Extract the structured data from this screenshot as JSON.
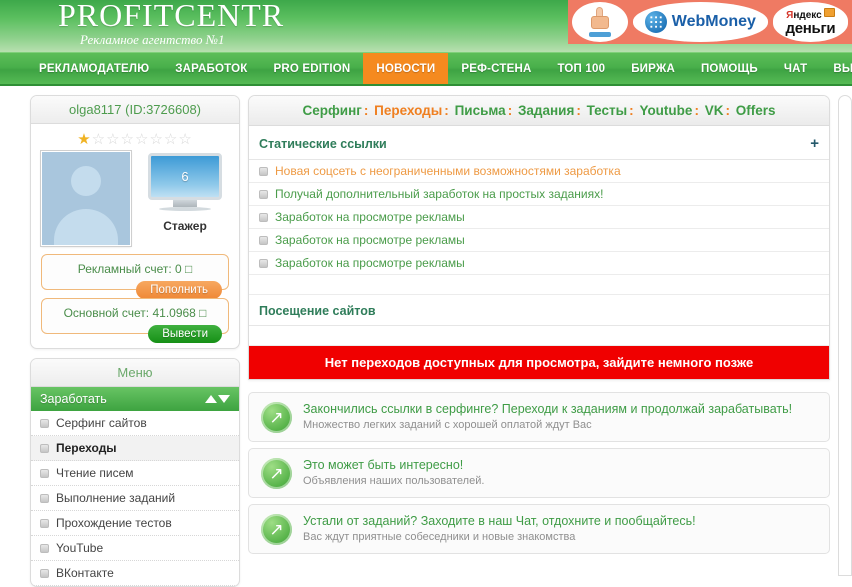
{
  "header": {
    "brand_title": "PROFITCENTR",
    "brand_subtitle": "Рекламное агентство №1",
    "banner": {
      "hand_icon": "hand-click-icon",
      "webmoney_label": "WebMoney",
      "yandex_top": "Яндекс",
      "yandex_bottom": "деньги"
    }
  },
  "nav": {
    "items": [
      {
        "label": "РЕКЛАМОДАТЕЛЮ",
        "active": false
      },
      {
        "label": "ЗАРАБОТОК",
        "active": false
      },
      {
        "label": "PRO EDITION",
        "active": false
      },
      {
        "label": "НОВОСТИ",
        "active": true
      },
      {
        "label": "РЕФ-СТЕНА",
        "active": false
      },
      {
        "label": "ТОП 100",
        "active": false
      },
      {
        "label": "БИРЖА",
        "active": false
      },
      {
        "label": "ПОМОЩЬ",
        "active": false
      },
      {
        "label": "ЧАТ",
        "active": false
      },
      {
        "label": "ВЫХОД",
        "active": false
      }
    ]
  },
  "sidebar": {
    "user": {
      "name_id": "olga8117 (ID:3726608)",
      "stars_total": 8,
      "stars_filled": 1,
      "monitor_value": "6",
      "rank_label": "Стажер"
    },
    "accounts": [
      {
        "text": "Рекламный счет: 0 □",
        "button": "Пополнить",
        "button_color": "#ef8836"
      },
      {
        "text": "Основной счет: 41.0968 □",
        "button": "Вывести",
        "button_color": "#169016"
      }
    ],
    "menu_title": "Меню",
    "menu_section": "Заработать",
    "menu_items": [
      {
        "label": "Серфинг сайтов",
        "active": false
      },
      {
        "label": "Переходы",
        "active": true
      },
      {
        "label": "Чтение писем",
        "active": false
      },
      {
        "label": "Выполнение заданий",
        "active": false
      },
      {
        "label": "Прохождение тестов",
        "active": false
      },
      {
        "label": "YouTube",
        "active": false
      },
      {
        "label": "ВКонтакте",
        "active": false
      }
    ]
  },
  "main": {
    "tabs": [
      {
        "label": "Серфинг",
        "active": false
      },
      {
        "label": "Переходы",
        "active": true
      },
      {
        "label": "Письма",
        "active": false
      },
      {
        "label": "Задания",
        "active": false
      },
      {
        "label": "Тесты",
        "active": false
      },
      {
        "label": "Youtube",
        "active": false
      },
      {
        "label": "VK",
        "active": false
      },
      {
        "label": "Offers",
        "active": false
      }
    ],
    "tab_separator": ":",
    "static_section": {
      "title": "Статические ссылки",
      "toggle": "+",
      "links": [
        {
          "label": "Новая соцсеть с неограниченными возможностями заработка",
          "visited": true
        },
        {
          "label": "Получай дополнительный заработок на простых заданиях!",
          "visited": false
        },
        {
          "label": "Заработок на просмотре рекламы",
          "visited": false
        },
        {
          "label": "Заработок на просмотре рекламы",
          "visited": false
        },
        {
          "label": "Заработок на просмотре рекламы",
          "visited": false
        }
      ]
    },
    "visits_section": {
      "title": "Посещение сайтов"
    },
    "alert": "Нет переходов доступных для просмотра, зайдите немного позже",
    "promos": [
      {
        "title": "Закончились ссылки в серфинге? Переходи к заданиям и продолжай зарабатывать!",
        "subtitle": "Множество легких заданий с хорошей оплатой ждут Вас"
      },
      {
        "title": "Это может быть интересно!",
        "subtitle": "Объявления наших пользователей."
      },
      {
        "title": "Устали от заданий? Заходите в наш Чат, отдохните и пообщайтесь!",
        "subtitle": "Вас ждут приятные собеседники и новые знакомства"
      }
    ]
  },
  "colors": {
    "brand_green": "#3ea343",
    "accent_orange": "#f58a1f",
    "alert_red": "#f00000",
    "banner_salmon": "#ef7a63"
  }
}
